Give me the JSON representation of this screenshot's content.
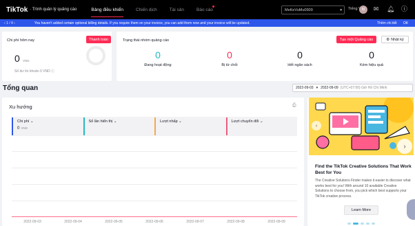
{
  "header": {
    "logo": "TikTok",
    "logo_sub": "· Trình quản lý quảng cáo",
    "nav": [
      {
        "label": "Bảng điều khiển",
        "active": true
      },
      {
        "label": "Chiến dịch",
        "active": false
      },
      {
        "label": "Tài sản",
        "active": false
      },
      {
        "label": "Báo cáo",
        "active": false
      }
    ],
    "account": "MeKeVuMu0909",
    "language": "Tiếng Việt",
    "avatar_initial": "M"
  },
  "banner": {
    "pager": "‹ 1 / 4 ›",
    "message": "You haven't added certain optional billing details. If you require them on your invoice, you can add them now and your invoice will be updated.",
    "link": "Thêm chi tiết",
    "ok": "OK"
  },
  "spend": {
    "title": "Chi phí hôm nay",
    "pay_button": "Thanh toán",
    "amount": "0",
    "currency": "VND",
    "credit": "Số dư tín khoản 0 VND ⓘ"
  },
  "status": {
    "title": "Trạng thái nhóm quảng cáo",
    "create_button": "Tạo một Quảng cáo",
    "log_button": "Nhật ký",
    "items": [
      {
        "value": "0",
        "label": "Đang hoạt động",
        "color": "#20b9c4"
      },
      {
        "value": "0",
        "label": "Bị từ chối",
        "color": "#fe2c55"
      },
      {
        "value": "0",
        "label": "Hết ngân sách",
        "color": "#161823"
      },
      {
        "value": "0",
        "label": "Kém hiệu quả",
        "color": "#161823"
      }
    ]
  },
  "overview": {
    "title": "Tổng quan",
    "date_from": "2022-09-03",
    "date_to": "2022-09-09",
    "timezone": "(UTC+07:00) Giờ Hồ Chí Minh"
  },
  "trends": {
    "title": "Xu hướng",
    "metrics": [
      {
        "label": "Chi phí",
        "value": "0",
        "unit": "VND",
        "color": "#2e55ea"
      },
      {
        "label": "Số lần hiển thị",
        "value": "",
        "unit": "",
        "color": "#20b9c4"
      },
      {
        "label": "Lượt nhấp",
        "value": "",
        "unit": "",
        "color": "#f3a84d"
      },
      {
        "label": "Lượt chuyển đổi",
        "value": "",
        "unit": "",
        "color": "#e85b7d"
      }
    ],
    "x_ticks": [
      "2022-09-03",
      "2022-09-04",
      "2022-09-05",
      "2022-09-06",
      "2022-09-07",
      "2022-09-08",
      "2022-09-09"
    ]
  },
  "promo": {
    "title": "Find the TikTok Creative Solutions That Work Best for You",
    "text": "The Creative Solutions Finder makes it easier to discover what works best for you! With around 10 available Creative Solutions to choose from, you pick which best supports your TikTok creative process.",
    "button": "Learn More"
  }
}
